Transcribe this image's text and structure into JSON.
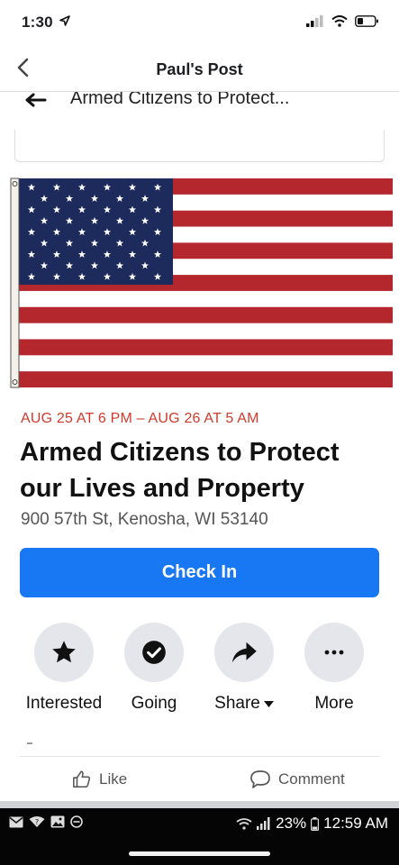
{
  "status": {
    "time": "1:30",
    "location_icon": "location-arrow-icon"
  },
  "nav": {
    "title": "Paul's Post"
  },
  "subheader": {
    "title": "Armed Citizens to Protect..."
  },
  "event": {
    "date": "AUG 25 AT 6 PM – AUG 26 AT 5 AM",
    "title": "Armed Citizens to Protect our Lives and Property",
    "address": "900 57th St, Kenosha, WI 53140",
    "checkin_label": "Check In"
  },
  "actions": [
    {
      "label": "Interested",
      "icon": "star-icon"
    },
    {
      "label": "Going",
      "icon": "check-circle-icon"
    },
    {
      "label": "Share",
      "icon": "share-arrow-icon"
    },
    {
      "label": "More",
      "icon": "more-dots-icon"
    }
  ],
  "footer": {
    "like_label": "Like",
    "comment_label": "Comment"
  },
  "android": {
    "battery": "23%",
    "time": "12:59 AM"
  },
  "colors": {
    "accent": "#1877f2",
    "date_red": "#d0392b",
    "flag_red": "#b3272d",
    "flag_blue": "#1d2a5c"
  }
}
